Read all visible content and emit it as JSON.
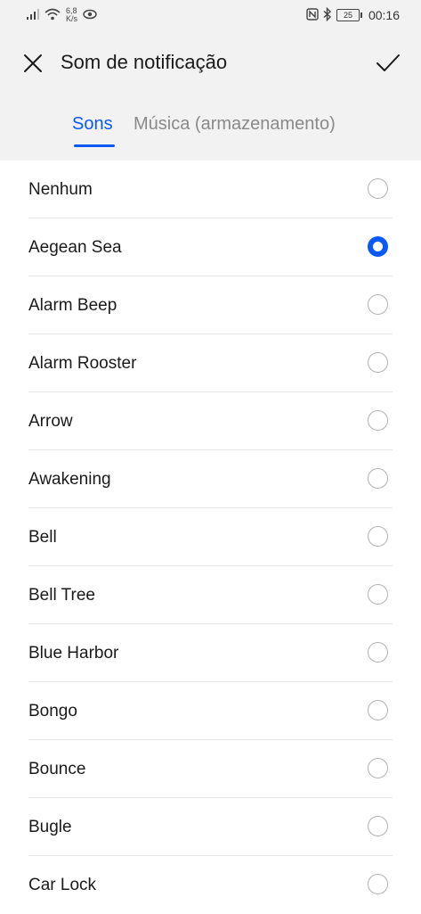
{
  "status_bar": {
    "speed_value": "6,8",
    "speed_unit": "K/s",
    "battery": "25",
    "time": "00:16",
    "icons": [
      "signal-icon",
      "wifi-icon",
      "eye-icon",
      "nfc-icon",
      "bluetooth-icon",
      "battery-icon"
    ]
  },
  "header": {
    "title": "Som de notificação",
    "close_icon": "close-icon",
    "confirm_icon": "check-icon"
  },
  "tabs": [
    {
      "label": "Sons",
      "active": true
    },
    {
      "label": "Música (armazenamento)",
      "active": false
    }
  ],
  "sounds": [
    {
      "label": "Nenhum",
      "selected": false
    },
    {
      "label": "Aegean Sea",
      "selected": true
    },
    {
      "label": "Alarm Beep",
      "selected": false
    },
    {
      "label": "Alarm Rooster",
      "selected": false
    },
    {
      "label": "Arrow",
      "selected": false
    },
    {
      "label": "Awakening",
      "selected": false
    },
    {
      "label": "Bell",
      "selected": false
    },
    {
      "label": "Bell Tree",
      "selected": false
    },
    {
      "label": "Blue Harbor",
      "selected": false
    },
    {
      "label": "Bongo",
      "selected": false
    },
    {
      "label": "Bounce",
      "selected": false
    },
    {
      "label": "Bugle",
      "selected": false
    },
    {
      "label": "Car Lock",
      "selected": false
    }
  ],
  "colors": {
    "accent": "#0a59f7",
    "header_bg": "#f2f2f2",
    "inactive_tab": "#8a8a8a",
    "radio_border": "#b3b3b3"
  }
}
